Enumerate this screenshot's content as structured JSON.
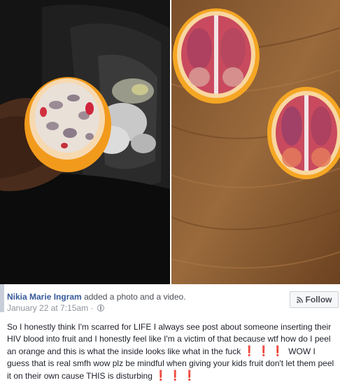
{
  "post": {
    "author": "Nikia Marie Ingram",
    "action": "added a photo and a video.",
    "timestamp": "January 22 at 7:15am",
    "separator": "·",
    "privacy_icon": "globe-icon",
    "follow_label": "Follow",
    "follow_icon": "rss-icon",
    "text_part1": "So I honestly think I'm scarred for LIFE I always see post about someone inserting their HIV blood into fruit and I honestly feel like I'm a victim of that because wtf how do I peel an orange and this is what the inside looks like what in the fuck",
    "emoji_1": "❗❗❗",
    "text_part2": "WOW I guess that is real smfh wow plz be mindful when giving your kids fruit don't let them peel it on their own cause THIS is disturbing",
    "emoji_2": "❗❗❗"
  },
  "colors": {
    "link": "#365899",
    "meta": "#90949c",
    "text": "#1d2129",
    "exclamation": "#e0201b"
  }
}
